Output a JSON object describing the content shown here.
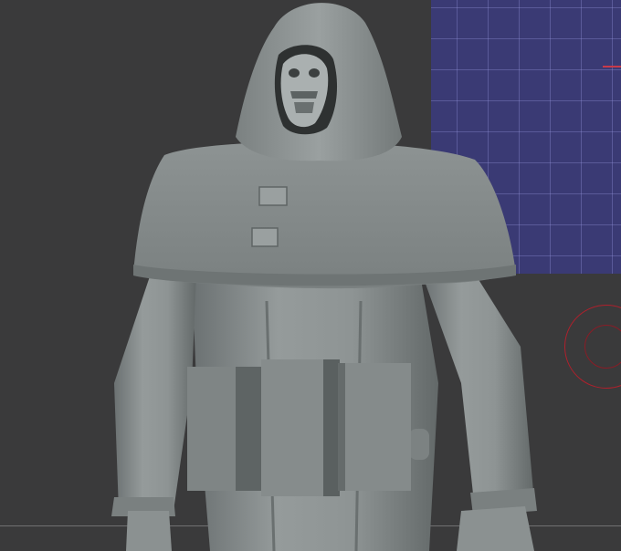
{
  "viewport": {
    "background_color": "#3a3a3b",
    "grid_color": "#3a3a74",
    "model_color": "#8a9091",
    "gizmo_color": "#b0202c"
  },
  "icons": [
    "grid-plane",
    "transform-gizmo-ring"
  ]
}
